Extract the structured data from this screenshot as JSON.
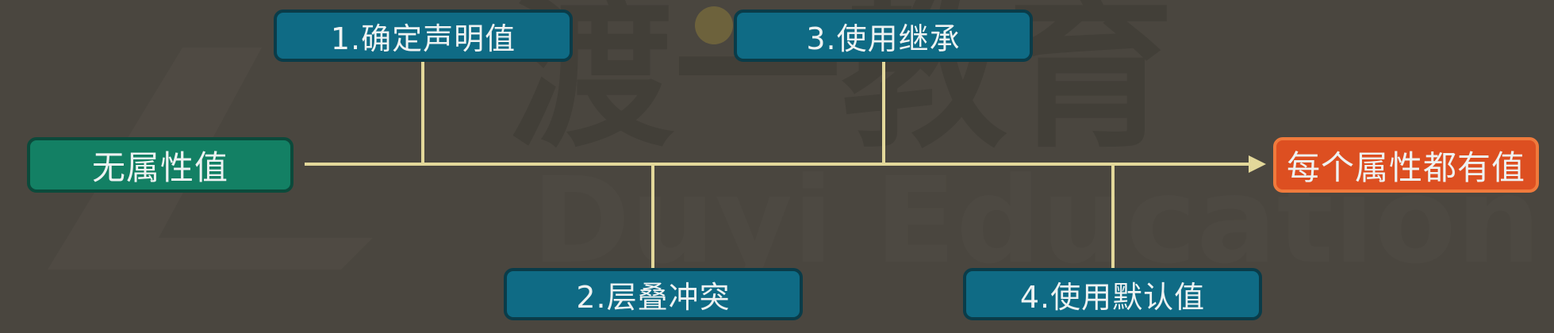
{
  "diagram": {
    "start": {
      "label": "无属性值"
    },
    "end": {
      "label": "每个属性都有值"
    },
    "steps": [
      {
        "label": "1.确定声明值"
      },
      {
        "label": "2.层叠冲突"
      },
      {
        "label": "3.使用继承"
      },
      {
        "label": "4.使用默认值"
      }
    ]
  },
  "watermark": {
    "text_cn": "渡一教育",
    "text_en": "Duyi Education"
  },
  "colors": {
    "background": "#4a463f",
    "connector": "#e3d89a",
    "step_box": "#0f6b85",
    "start_box": "#138064",
    "end_box": "#dd4f21"
  }
}
